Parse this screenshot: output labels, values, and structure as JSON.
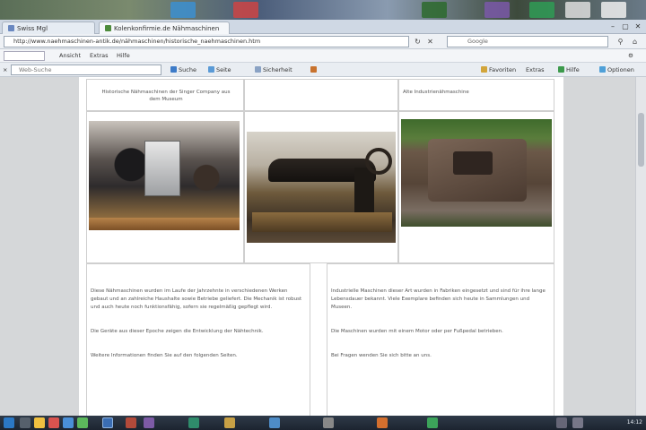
{
  "browser": {
    "tabs": [
      {
        "label": "Swiss Mgl"
      },
      {
        "label": "Kolenkonfirmie.de Nähmaschinen"
      }
    ],
    "address": "http://www.naehmaschinen-antik.de/nähmaschinen/historische_naehmaschinen.htm",
    "search_placeholder": "Google",
    "window_controls": {
      "minimize": "–",
      "maximize": "▢",
      "close": "✕"
    }
  },
  "menubar": {
    "items": [
      {
        "label": "Ansicht"
      },
      {
        "label": "Extras"
      },
      {
        "label": "Hilfe"
      }
    ]
  },
  "toolbar": {
    "search_placeholder": "Web-Suche",
    "items": [
      {
        "label": "Suche"
      },
      {
        "label": "Seite"
      },
      {
        "label": "Sicherheit"
      }
    ],
    "right_items": [
      {
        "label": "Favoriten"
      },
      {
        "label": "Extras"
      },
      {
        "label": "Hilfe"
      },
      {
        "label": "Optionen"
      }
    ]
  },
  "content": {
    "captions": [
      "Historische Nähmaschinen der Singer Company aus dem Museum",
      "",
      "Alte Industrienähmaschine"
    ],
    "left_paragraphs": [
      "Diese Nähmaschinen wurden im Laufe der Jahrzehnte in verschiedenen Werken gebaut und an zahlreiche Haushalte sowie Betriebe geliefert. Die Mechanik ist robust und auch heute noch funktionsfähig, sofern sie regelmäßig gepflegt wird.",
      "Die Geräte aus dieser Epoche zeigen die Entwicklung der Nähtechnik.",
      "Weitere Informationen finden Sie auf den folgenden Seiten."
    ],
    "right_paragraphs": [
      "Industrielle Maschinen dieser Art wurden in Fabriken eingesetzt und sind für ihre lange Lebensdauer bekannt. Viele Exemplare befinden sich heute in Sammlungen und Museen.",
      "Die Maschinen wurden mit einem Motor oder per Fußpedal betrieben.",
      "Bei Fragen wenden Sie sich bitte an uns."
    ]
  },
  "taskbar": {
    "clock": "14:12"
  }
}
